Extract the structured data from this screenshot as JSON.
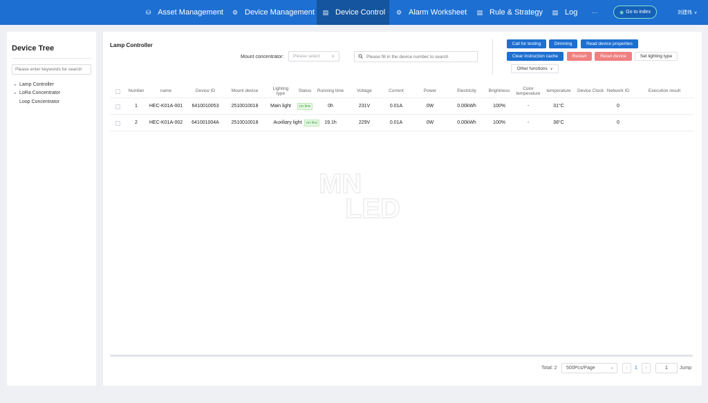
{
  "nav": {
    "items": [
      {
        "label": "Asset Management",
        "icon": "database-icon",
        "glyph": "⛁"
      },
      {
        "label": "Device Management",
        "icon": "gear-icon",
        "glyph": "⚙"
      },
      {
        "label": "Device Control",
        "icon": "document-icon",
        "glyph": "▤"
      },
      {
        "label": "Alarm Worksheet",
        "icon": "gear-icon",
        "glyph": "⚙"
      },
      {
        "label": "Rule & Strategy",
        "icon": "list-icon",
        "glyph": "▤"
      },
      {
        "label": "Log",
        "icon": "document-icon",
        "glyph": "▤"
      }
    ],
    "more": "···",
    "active": "Device Control",
    "goto_label": "Go to index",
    "user_name": "刘建伟"
  },
  "sidebar": {
    "title": "Device Tree",
    "search_placeholder": "Please enter keywords for search",
    "tree": [
      {
        "label": "Lamp Controller"
      },
      {
        "label": "LoRa Concentrator"
      },
      {
        "label": "Loop Concentrator"
      }
    ]
  },
  "main": {
    "title": "Lamp Controller",
    "mount_label": "Mount concentrator:",
    "mount_placeholder": "Please select",
    "search_placeholder": "Please fill in the device number to search",
    "buttons": {
      "call_testing": "Call for testing",
      "dimming": "Dimming",
      "read_props": "Read device properties",
      "clear_cache": "Clear instruction cache",
      "restart": "Restart",
      "reset_device": "Reset device",
      "set_lighting": "Set lighting type",
      "other_functions": "Other functions"
    },
    "columns": [
      "Number",
      "name",
      "Device ID",
      "Mount device",
      "Lighting type",
      "Status",
      "Running time",
      "Voltage",
      "Current",
      "Power",
      "Electricity",
      "Brightness",
      "Color temperature",
      "temperature",
      "Device Clock",
      "Network ID",
      "Execution result"
    ],
    "rows": [
      [
        "1",
        "HEC-K01A-001",
        "6410010053",
        "2510010018",
        "Main light",
        "on-line",
        "0h",
        "231V",
        "0.01A",
        "0W",
        "0.00kWh",
        "100%",
        "-",
        "31°C",
        "",
        "0",
        ""
      ],
      [
        "2",
        "HEC-K01A-002",
        "641001004A",
        "2510010018",
        "Auxiliary light",
        "on-line",
        "19.1h",
        "229V",
        "0.01A",
        "0W",
        "0.00kWh",
        "100%",
        "-",
        "38°C",
        "",
        "0",
        ""
      ]
    ],
    "watermark": {
      "top": "MN",
      "bottom": "LED"
    },
    "pagination": {
      "total": "Total: 2",
      "page_size": "500Pcs/Page",
      "current_page": "1",
      "jump_value": "1",
      "jump_label": "Jump",
      "prev": "‹",
      "next": "›"
    }
  },
  "colors": {
    "nav_bg": "#1d6fd1",
    "nav_active": "#15559f",
    "danger": "#f08080",
    "online": "#3aa534"
  }
}
